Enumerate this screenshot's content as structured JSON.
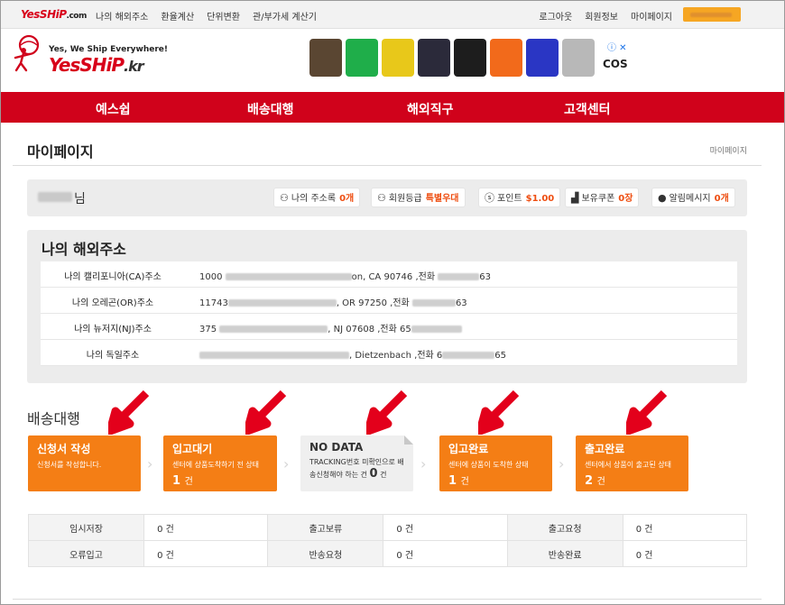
{
  "topbar": {
    "logo": "YesSHiP",
    "logo_suffix": ".com",
    "links": [
      "나의 해외주소",
      "환율계산",
      "단위변환",
      "관/부가세 계산기"
    ],
    "right_links": [
      "로그아웃",
      "회원정보",
      "마이페이지"
    ]
  },
  "header": {
    "tagline": "Yes, We Ship Everywhere!",
    "brand": "YesSHiP",
    "brand_suffix": ".kr",
    "ad_brand": "COS",
    "ad_info": "ⓘ ✕"
  },
  "mainnav": [
    "예스쉽",
    "배송대행",
    "해외직구",
    "고객센터"
  ],
  "page": {
    "title": "마이페이지",
    "breadcrumb": "마이페이지"
  },
  "user": {
    "suffix": "님",
    "chips": [
      {
        "icon": "address-book-icon",
        "label": "나의 주소록",
        "value": "0개"
      },
      {
        "icon": "member-level-icon",
        "label": "회원등급",
        "value": "특별우대"
      },
      {
        "icon": "point-icon",
        "label": "포인트",
        "value": "$1.00"
      },
      {
        "icon": "coupon-icon",
        "label": "보유쿠폰",
        "value": "0장"
      },
      {
        "icon": "message-icon",
        "label": "알림메시지",
        "value": "0개"
      }
    ]
  },
  "addresses": {
    "title": "나의 해외주소",
    "rows": [
      {
        "label": "나의 캘리포니아(CA)주소",
        "a": "1000",
        "b": "on, CA  90746  ,전화",
        "c": "63"
      },
      {
        "label": "나의 오레곤(OR)주소",
        "a": "11743",
        "b": ", OR  97250  ,전화",
        "c": "63"
      },
      {
        "label": "나의 뉴저지(NJ)주소",
        "a": "375",
        "b": ", NJ  07608  ,전화 65",
        "c": ""
      },
      {
        "label": "나의 독일주소",
        "a": "",
        "b": ", Dietzenbach  ,전화 6",
        "c": "65"
      }
    ]
  },
  "shipping": {
    "title": "배송대행",
    "cards": [
      {
        "title": "신청서 작성",
        "desc": "신청서를 작성합니다.",
        "count": "",
        "unit": ""
      },
      {
        "title": "입고대기",
        "desc": "센터에 상품도착하기 전 상태",
        "count": "1",
        "unit": "건"
      },
      {
        "title": "NO DATA",
        "desc": "TRACKING번호 미확인으로 배송신청해야 하는 건",
        "count": "0",
        "unit": "건"
      },
      {
        "title": "입고완료",
        "desc": "센터에 상품이 도착한 상태",
        "count": "1",
        "unit": "건"
      },
      {
        "title": "출고완료",
        "desc": "센터에서 상품이 출고된 상태",
        "count": "2",
        "unit": "건"
      }
    ]
  },
  "status_table": [
    [
      {
        "k": "임시저장",
        "v": "0 건"
      },
      {
        "k": "출고보류",
        "v": "0 건"
      },
      {
        "k": "출고요청",
        "v": "0 건"
      }
    ],
    [
      {
        "k": "오류입고",
        "v": "0 건"
      },
      {
        "k": "반송요청",
        "v": "0 건"
      },
      {
        "k": "반송완료",
        "v": "0 건"
      }
    ]
  ],
  "colors": {
    "brand_red": "#d0021b",
    "card_orange": "#f47e15",
    "accent": "#ee4d10"
  }
}
